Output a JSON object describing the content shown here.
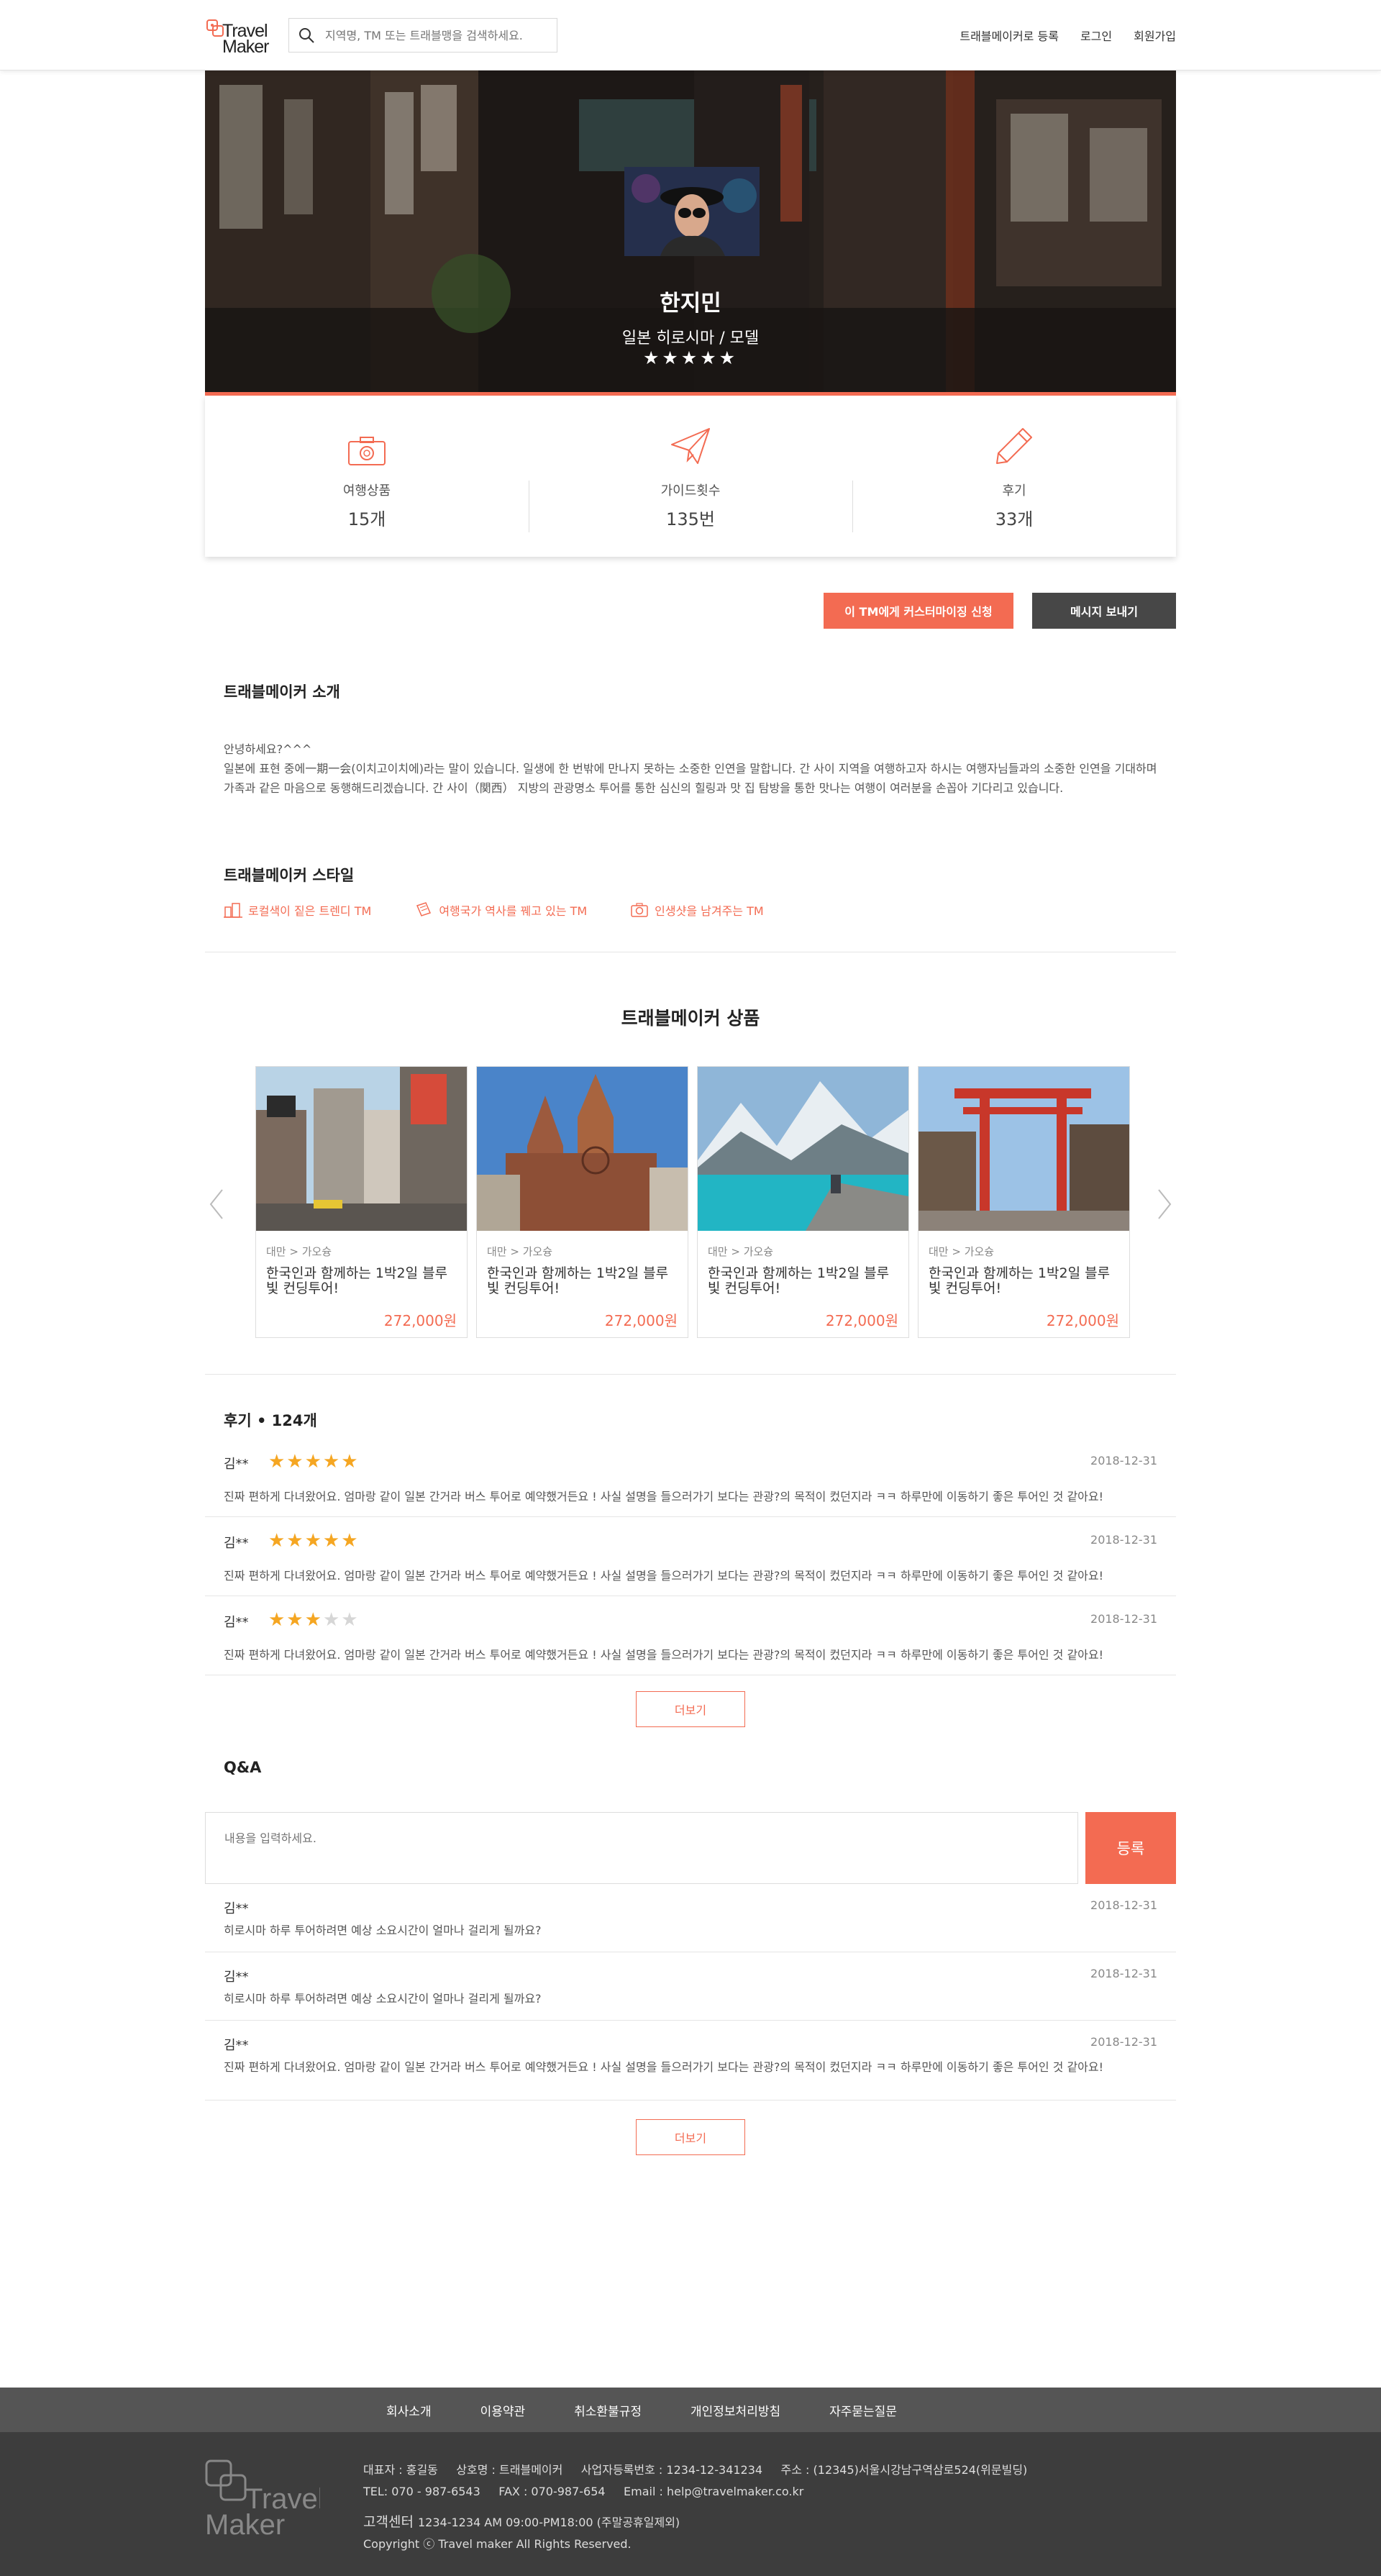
{
  "header": {
    "logo_line1": "Travel",
    "logo_line2": "Maker",
    "search_placeholder": "지역명, TM 또는 트래블맹을 검색하세요.",
    "nav": [
      "트래블메이커로 등록",
      "로그인",
      "회원가입"
    ]
  },
  "profile": {
    "name": "한지민",
    "subtitle": "일본 히로시마 / 모델",
    "stars": "★★★★★"
  },
  "stats": [
    {
      "icon": "camera-icon",
      "label": "여행상품",
      "value": "15개"
    },
    {
      "icon": "paper-plane-icon",
      "label": "가이드횟수",
      "value": "135번"
    },
    {
      "icon": "pencil-icon",
      "label": "후기",
      "value": "33개"
    }
  ],
  "actions": {
    "custom": "이 TM에게 커스터마이징 신청",
    "message": "메시지 보내기"
  },
  "intro": {
    "title": "트래블메이커 소개",
    "line1": "안녕하세요?^^^",
    "body": "일본에 표현 중에一期一会(이치고이치에)라는 말이 있습니다. 일생에 한 번밖에 만나지 못하는 소중한 인연을 말합니다. 간 사이 지역을 여행하고자 하시는 여행자님들과의 소중한 인연을 기대하며 가족과 같은 마음으로 동행해드리겠습니다. 간 사이（関西） 지방의 관광명소 투어를 통한 심신의 힐링과 맛 집 탐방을 통한 맛나는 여행이 여러분을 손꼽아 기다리고 있습니다."
  },
  "style": {
    "title": "트래블메이커 스타일",
    "tags": [
      {
        "icon": "city-icon",
        "label": "로컬색이 짙은 트렌디 TM"
      },
      {
        "icon": "scroll-icon",
        "label": "여행국가 역사를 꿰고 있는 TM"
      },
      {
        "icon": "camera-icon",
        "label": "인생샷을 남겨주는 TM"
      }
    ]
  },
  "products": {
    "title": "트래블메이커 상품",
    "items": [
      {
        "category": "대만 > 가오슝",
        "title": "한국인과 함께하는 1박2일 블루빛 컨딩투어!",
        "price": "272,000원"
      },
      {
        "category": "대만 > 가오슝",
        "title": "한국인과 함께하는 1박2일 블루빛 컨딩투어!",
        "price": "272,000원"
      },
      {
        "category": "대만 > 가오슝",
        "title": "한국인과 함께하는 1박2일 블루빛 컨딩투어!",
        "price": "272,000원"
      },
      {
        "category": "대만 > 가오슝",
        "title": "한국인과 함께하는 1박2일 블루빛 컨딩투어!",
        "price": "272,000원"
      }
    ]
  },
  "reviews": {
    "title": "후기 • 124개",
    "items": [
      {
        "name": "김**",
        "rating": 5,
        "date": "2018-12-31",
        "text": "진짜 편하게 다녀왔어요. 엄마랑 같이 일본 간거라 버스 투어로 예약했거든요 ! 사실 설명을 들으러가기 보다는 관광?의 목적이 컸던지라 ㅋㅋ 하루만에 이동하기 좋은 투어인 것 같아요!"
      },
      {
        "name": "김**",
        "rating": 5,
        "date": "2018-12-31",
        "text": "진짜 편하게 다녀왔어요. 엄마랑 같이 일본 간거라 버스 투어로 예약했거든요 ! 사실 설명을 들으러가기 보다는 관광?의 목적이 컸던지라 ㅋㅋ 하루만에 이동하기 좋은 투어인 것 같아요!"
      },
      {
        "name": "김**",
        "rating": 3,
        "date": "2018-12-31",
        "text": "진짜 편하게 다녀왔어요. 엄마랑 같이 일본 간거라 버스 투어로 예약했거든요 ! 사실 설명을 들으러가기 보다는 관광?의 목적이 컸던지라 ㅋㅋ 하루만에 이동하기 좋은 투어인 것 같아요!"
      }
    ],
    "more": "더보기"
  },
  "qa": {
    "title": "Q&A",
    "placeholder": "내용을 입력하세요.",
    "submit": "등록",
    "items": [
      {
        "name": "김**",
        "date": "2018-12-31",
        "text": "히로시마 하루 투어하려면 예상 소요시간이 얼마나 걸리게 될까요?"
      },
      {
        "name": "김**",
        "date": "2018-12-31",
        "text": "히로시마 하루 투어하려면 예상 소요시간이 얼마나 걸리게 될까요?"
      },
      {
        "name": "김**",
        "date": "2018-12-31",
        "text": "진짜 편하게 다녀왔어요. 엄마랑 같이 일본 간거라 버스 투어로 예약했거든요 ! 사실 설명을 들으러가기 보다는 관광?의 목적이 컸던지라 ㅋㅋ 하루만에 이동하기 좋은 투어인 것 같아요!"
      }
    ],
    "more": "더보기"
  },
  "footer": {
    "nav": [
      "회사소개",
      "이용약관",
      "취소환불규정",
      "개인정보처리방침",
      "자주묻는질문"
    ],
    "line1": "대표자 : 홍길동     상호명 : 트래블메이커     사업자등록번호 : 1234-12-341234     주소 : (12345)서울시강남구역삼로524(위문빌딩)",
    "line2": "TEL: 070 - 987-6543     FAX : 070-987-654     Email : help@travelmaker.co.kr",
    "cs_label": "고객센터",
    "cs_hours": "1234-1234   AM 09:00-PM18:00 (주말공휴일제외)",
    "copyright": "Copyright ⓒ Travel maker All Rights Reserved."
  },
  "colors": {
    "accent": "#f36b52",
    "dark_button": "#474747",
    "footer_nav": "#555555",
    "footer": "#3d3d3d",
    "star": "#f5a622"
  }
}
